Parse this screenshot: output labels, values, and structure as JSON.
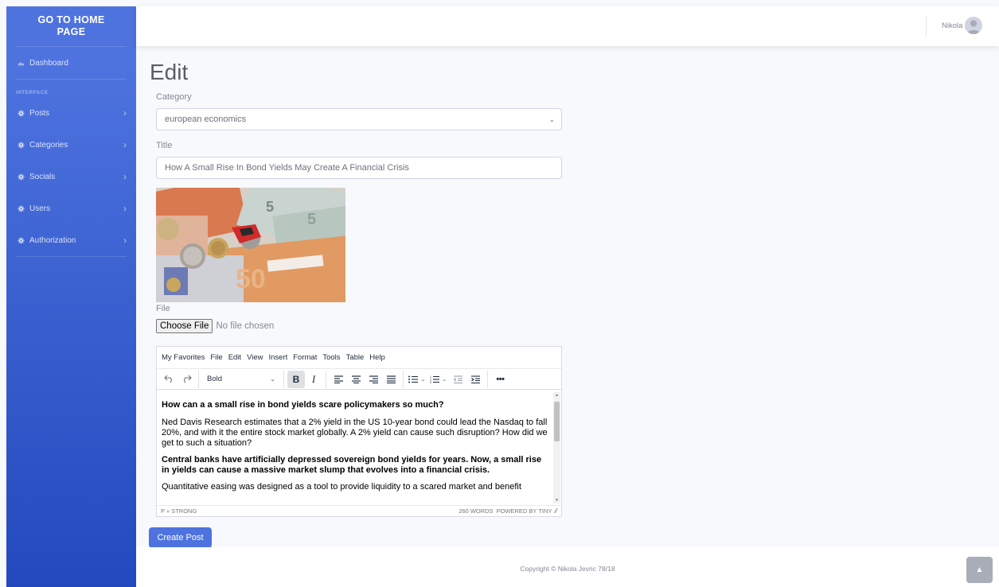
{
  "sidebar": {
    "brand": "GO TO HOME PAGE",
    "dashboard_label": "Dashboard",
    "heading": "INTERFACE",
    "items": [
      {
        "label": "Posts"
      },
      {
        "label": "Categories"
      },
      {
        "label": "Socials"
      },
      {
        "label": "Users"
      },
      {
        "label": "Authorization"
      }
    ]
  },
  "topbar": {
    "user_name": "Nikola"
  },
  "main": {
    "title": "Edit",
    "category_label": "Category",
    "category_value": "european economics",
    "title_label": "Title",
    "title_value": "How A Small Rise In Bond Yields May Create A Financial Crisis",
    "file_label": "File",
    "file_button": "Choose File",
    "file_status": "No file chosen",
    "create_button": "Create Post"
  },
  "editor": {
    "menu": [
      "My Favorites",
      "File",
      "Edit",
      "View",
      "Insert",
      "Format",
      "Tools",
      "Table",
      "Help"
    ],
    "block_format": "Bold",
    "content": {
      "heading": "How can a a small rise in bond yields scare policymakers so much?",
      "para1": "Ned Davis Research estimates that a 2% yield in the US 10-year bond could lead the Nasdaq to fall 20%, and with it the entire stock market globally. A 2% yield can cause such disruption? How did we get to such a situation?",
      "para2": "Central banks have artificially depressed sovereign bond yields for years. Now, a small rise in yields can cause a massive market slump that evolves into a financial crisis.",
      "para3": "Quantitative easing was designed as a tool to provide liquidity to a scared market and benefit"
    },
    "status_path": "P » STRONG",
    "word_count": "260 WORDS",
    "powered": "POWERED BY TINY"
  },
  "footer": {
    "copyright": "Copyright © Nikola Jevric 78/18"
  }
}
